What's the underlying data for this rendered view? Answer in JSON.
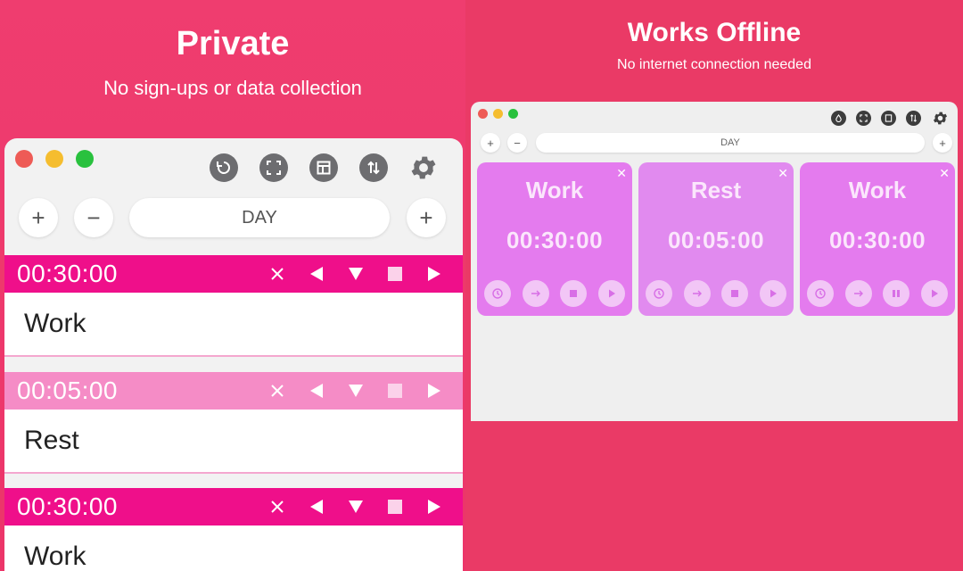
{
  "left": {
    "title": "Private",
    "subtitle": "No sign-ups or data collection",
    "toolbar_icons": [
      "reset-icon",
      "fullscreen-icon",
      "layout-icon",
      "sort-icon",
      "gear-icon"
    ],
    "add_label": "+",
    "remove_label": "−",
    "day_label": "DAY",
    "timers": [
      {
        "time": "00:30:00",
        "name": "Work",
        "active": true
      },
      {
        "time": "00:05:00",
        "name": "Rest",
        "active": false
      },
      {
        "time": "00:30:00",
        "name": "Work",
        "active": true
      }
    ],
    "row_controls": {
      "close": "✕",
      "prev": "◀",
      "down": "▼",
      "stop": "■",
      "play": "▶"
    }
  },
  "right": {
    "title": "Works Offline",
    "subtitle": "No internet connection needed",
    "toolbar_icons": [
      "drop-icon",
      "fullscreen-icon",
      "layout-icon",
      "sort-icon",
      "gear-icon"
    ],
    "add_label": "+",
    "remove_label": "−",
    "day_label": "DAY",
    "cards": [
      {
        "name": "Work",
        "time": "00:30:00",
        "close": "✕"
      },
      {
        "name": "Rest",
        "time": "00:05:00",
        "close": "✕"
      },
      {
        "name": "Work",
        "time": "00:30:00",
        "close": "✕"
      }
    ]
  },
  "colors": {
    "background": "#ee3a6c",
    "active_bar": "#ef0f8a",
    "inactive_bar": "#f58cc6",
    "card": "#e47bee",
    "traffic_red": "#ee5b56",
    "traffic_yellow": "#f5bd2f",
    "traffic_green": "#29c13e"
  }
}
